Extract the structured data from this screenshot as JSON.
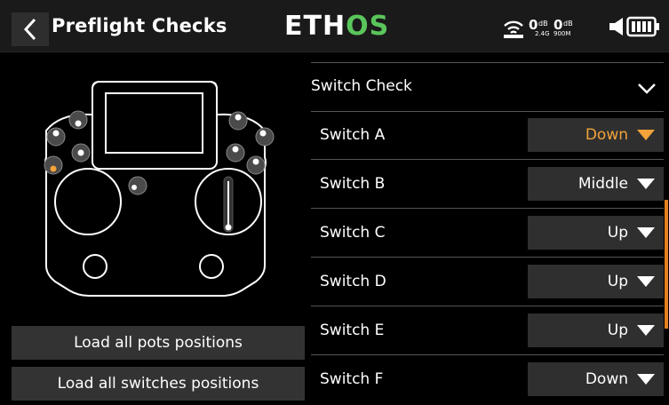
{
  "header": {
    "title": "Preflight Checks",
    "logo_part1": "ETH",
    "logo_part2": "OS",
    "signal1": "0",
    "signal2": "0",
    "unit": "dB",
    "band1": "2.4G",
    "band2": "900M"
  },
  "buttons": {
    "load_pots": "Load all pots positions",
    "load_switches": "Load all switches positions"
  },
  "section": {
    "title": "Switch Check"
  },
  "switches": [
    {
      "label": "Switch A",
      "value": "Down",
      "highlighted": true
    },
    {
      "label": "Switch B",
      "value": "Middle",
      "highlighted": false
    },
    {
      "label": "Switch C",
      "value": "Up",
      "highlighted": false
    },
    {
      "label": "Switch D",
      "value": "Up",
      "highlighted": false
    },
    {
      "label": "Switch E",
      "value": "Up",
      "highlighted": false
    },
    {
      "label": "Switch F",
      "value": "Down",
      "highlighted": false
    }
  ],
  "colors": {
    "accent": "#f2a33a",
    "logo_green": "#5ac55a",
    "scroll": "#e5801f"
  }
}
